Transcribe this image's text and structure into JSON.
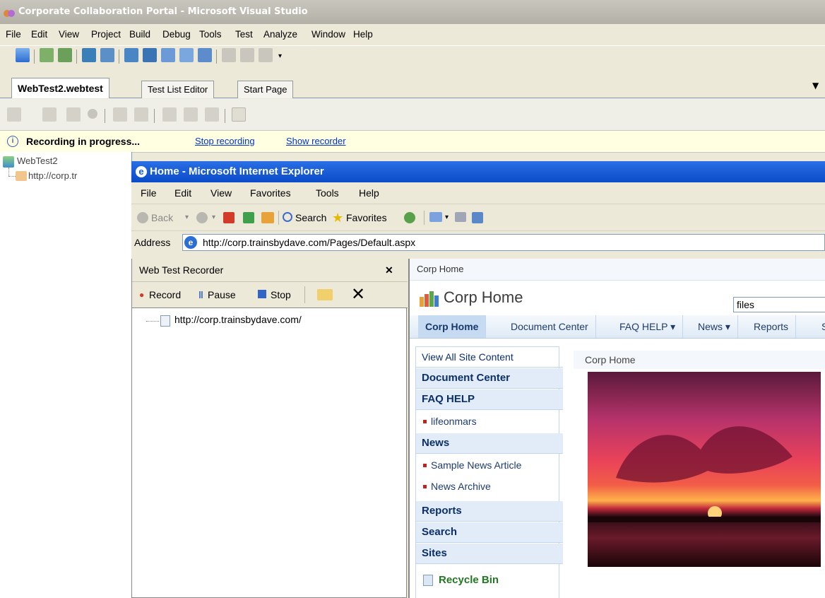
{
  "vs": {
    "title": "Corporate Collaboration Portal - Microsoft Visual Studio",
    "menu": [
      "File",
      "Edit",
      "View",
      "Project",
      "Build",
      "Debug",
      "Tools",
      "Test",
      "Analyze",
      "Window",
      "Help"
    ],
    "doc_tabs": [
      "WebTest2.webtest",
      "Test List Editor",
      "Start Page"
    ],
    "info": {
      "message": "Recording in progress...",
      "stop_link": "Stop recording",
      "show_link": "Show recorder"
    },
    "tree": {
      "root": "WebTest2",
      "child": "http://corp.tr"
    }
  },
  "ie": {
    "title": "Home - Microsoft Internet Explorer",
    "menu": [
      "File",
      "Edit",
      "View",
      "Favorites",
      "Tools",
      "Help"
    ],
    "toolbar": {
      "back": "Back",
      "search": "Search",
      "favorites": "Favorites"
    },
    "address_label": "Address",
    "address_value": "http://corp.trainsbydave.com/Pages/Default.aspx",
    "recorder": {
      "title": "Web Test Recorder",
      "close": "✕",
      "record": "Record",
      "pause": "Pause",
      "stop": "Stop",
      "tree_item": "http://corp.trainsbydave.com/"
    },
    "site": {
      "breadcrumb": "Corp Home",
      "site_title": "Corp Home",
      "search_value": "files",
      "top_nav": [
        "Corp Home",
        "Document Center",
        "FAQ HELP ▾",
        "News ▾",
        "Reports",
        "S"
      ],
      "quick_launch": {
        "view_all": "View All Site Content",
        "document_center": "Document Center",
        "faq_help": "FAQ HELP",
        "lifeonmars": "lifeonmars",
        "news": "News",
        "sample_news": "Sample News Article",
        "news_archive": "News Archive",
        "reports": "Reports",
        "search": "Search",
        "sites": "Sites",
        "recycle_bin": "Recycle Bin"
      },
      "page_title": "Corp Home"
    }
  }
}
